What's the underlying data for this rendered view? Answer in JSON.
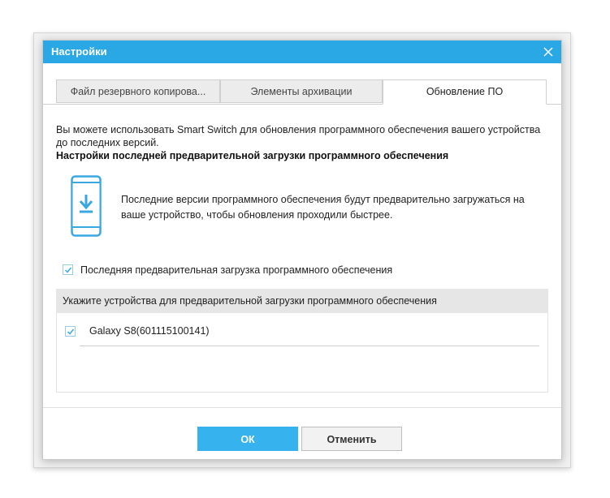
{
  "dialog": {
    "title": "Настройки",
    "close_icon": "close-icon"
  },
  "tabs": [
    {
      "label": "Файл резервного копирова...",
      "active": false
    },
    {
      "label": "Элементы архивации",
      "active": false
    },
    {
      "label": "Обновление ПО",
      "active": true
    }
  ],
  "content": {
    "intro": "Вы можете использовать Smart Switch для обновления программного обеспечения вашего устройства до последних версий.",
    "heading": "Настройки последней предварительной загрузки программного обеспечения",
    "phone_icon": "phone-download-icon",
    "info": "Последние версии программного обеспечения будут предварительно загружаться на ваше устройство, чтобы обновления проходили быстрее.",
    "preload_checkbox": {
      "label": "Последняя предварительная загрузка программного обеспечения",
      "checked": true
    },
    "device_panel_header": "Укажите устройства для предварительной загрузки программного обеспечения",
    "devices": [
      {
        "name": "Galaxy S8(601115100141)",
        "checked": true
      }
    ]
  },
  "buttons": {
    "ok": "ОК",
    "cancel": "Отменить"
  },
  "colors": {
    "accent": "#2aa8e6",
    "ok_button": "#36b3ef",
    "checkbox_check": "#3aa7e0"
  }
}
